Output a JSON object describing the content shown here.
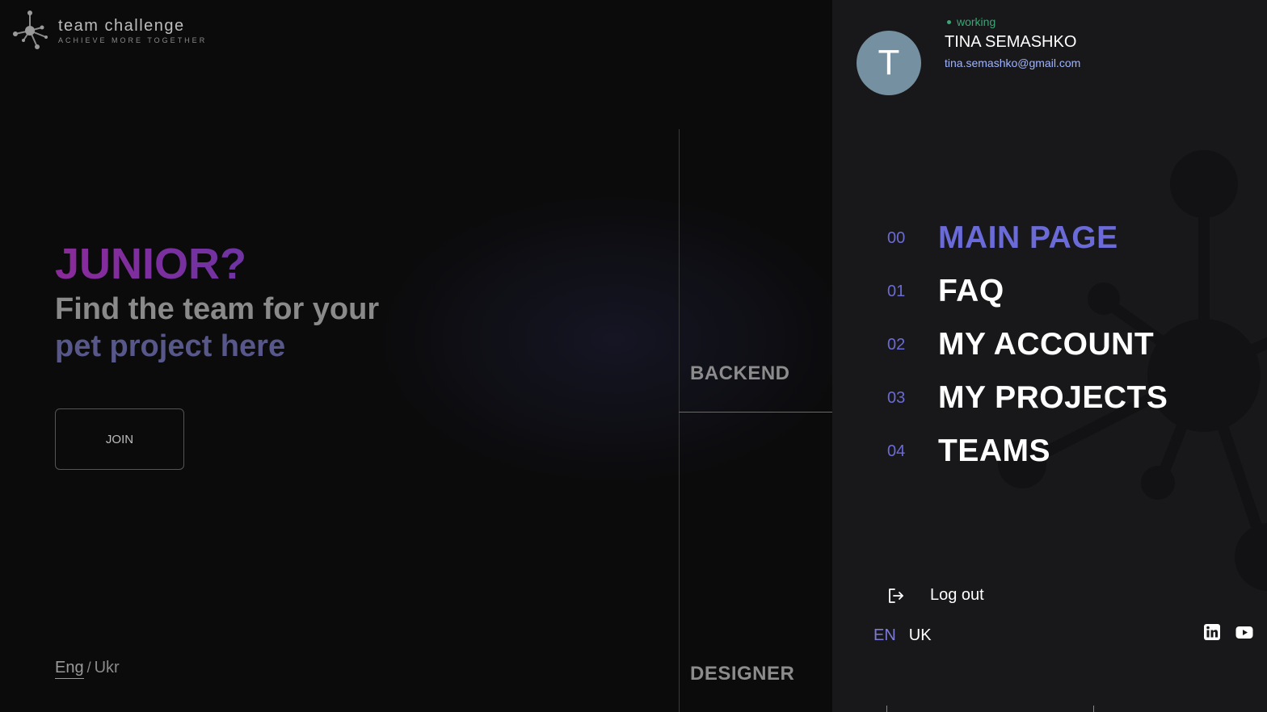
{
  "brand": {
    "title": "team challenge",
    "subtitle": "ACHIEVE MORE TOGETHER"
  },
  "hero": {
    "headline": "JUNIOR?",
    "line1": "Find the team for your",
    "line2": "pet project here",
    "join_label": "JOIN"
  },
  "lang_switch_left": {
    "active": "Eng",
    "separator": "/",
    "other": "Ukr"
  },
  "categories": {
    "backend": "BACKEND",
    "designer": "DESIGNER"
  },
  "user": {
    "initial": "T",
    "status": "working",
    "name": "TINA SEMASHKO",
    "email": "tina.semashko@gmail.com"
  },
  "menu": {
    "items": [
      {
        "num": "00",
        "label": "MAIN PAGE",
        "active": true
      },
      {
        "num": "01",
        "label": "FAQ",
        "active": false
      },
      {
        "num": "02",
        "label": "MY ACCOUNT",
        "active": false
      },
      {
        "num": "03",
        "label": "MY PROJECTS",
        "active": false
      },
      {
        "num": "04",
        "label": "TEAMS",
        "active": false
      }
    ],
    "logout_label": "Log out"
  },
  "lang_switch_right": {
    "en": "EN",
    "uk": "UK"
  },
  "icons": {
    "logo": "molecule-logo-icon",
    "logout": "logout-icon",
    "linkedin": "linkedin-icon",
    "youtube": "youtube-icon"
  },
  "colors": {
    "accent": "#6a6ad8",
    "status": "#3aa775",
    "panel_bg": "#18181b",
    "page_bg": "#0b0b0c",
    "avatar_bg": "#7590a0"
  }
}
